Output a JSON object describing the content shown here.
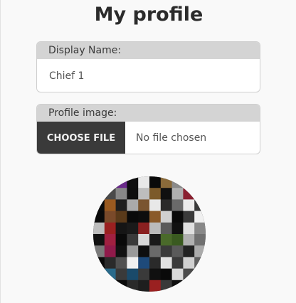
{
  "page": {
    "title": "My profile"
  },
  "display_name": {
    "label": "Display Name:",
    "value": "Chief 1"
  },
  "profile_image": {
    "label": "Profile image:",
    "button_label": "CHOOSE FILE",
    "status": "No file chosen"
  },
  "avatar": {
    "cols": 10,
    "rows": 10,
    "tiles": [
      "#111111",
      "#2a2a2a",
      "#6a2a8a",
      "#0f0f0f",
      "#e8e8e8",
      "#0a0a0a",
      "#8a6a3a",
      "#8a8a8a",
      "#1a1a1a",
      "#303030",
      "#151515",
      "#4a4a4a",
      "#888888",
      "#0e0e0e",
      "#bdbdbd",
      "#7c5a2a",
      "#101010",
      "#b0b0b0",
      "#8a2030",
      "#202020",
      "#0c0c0c",
      "#9a5a20",
      "#1e1e1e",
      "#aaaaaa",
      "#7a5530",
      "#e8e8e8",
      "#2a2a2a",
      "#6a6a6a",
      "#ececec",
      "#3a3a3a",
      "#0a0a0a",
      "#7a4a2a",
      "#5a3a1a",
      "#0a0a0a",
      "#0d0d0d",
      "#8a5a2a",
      "#d0d0d0",
      "#0a0a0a",
      "#3a3a3a",
      "#f0f0f0",
      "#bdbdbd",
      "#9a2020",
      "#151515",
      "#1a1a1a",
      "#8a2020",
      "#bbbbbb",
      "#5a5a5a",
      "#111111",
      "#e0e0e0",
      "#888888",
      "#111111",
      "#a02040",
      "#0a0a0a",
      "#3a3a3a",
      "#d8d8d8",
      "#1a1a1a",
      "#4a6a2a",
      "#3a5a20",
      "#b0b0b0",
      "#707070",
      "#7a7a7a",
      "#901a4a",
      "#111111",
      "#9a9a9a",
      "#0e0e0e",
      "#6a6a6a",
      "#3a3a3a",
      "#5a5a5a",
      "#222222",
      "#aaaaaa",
      "#0a0a0a",
      "#2a2a2a",
      "#505050",
      "#f0f0f0",
      "#1e4a7a",
      "#2a2a2a",
      "#e0e0e0",
      "#3a3a3a",
      "#d0d0d0",
      "#606060",
      "#0a0a0a",
      "#2a6a8a",
      "#3a3a3a",
      "#1a4a6a",
      "#3a3a3a",
      "#101010",
      "#0a0a0a",
      "#d8d8d8",
      "#4a4a4a",
      "#2a2a2a",
      "#111111",
      "#1a1a1a",
      "#0a0a0a",
      "#2a2a2a",
      "#1e1e1e",
      "#9a2020",
      "#3a3a3a",
      "#0f0f0f",
      "#c0c0c0",
      "#0a0a0a"
    ]
  }
}
